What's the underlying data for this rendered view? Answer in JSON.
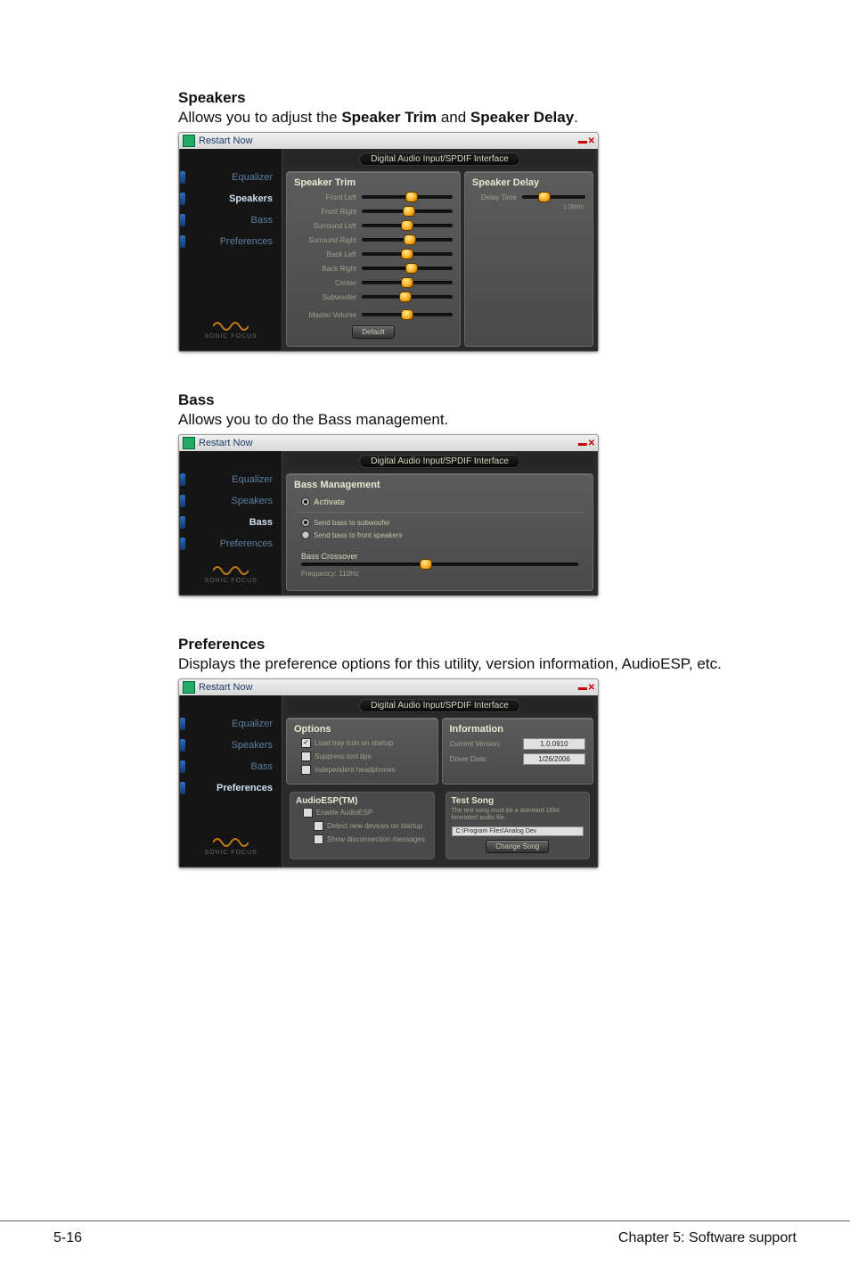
{
  "sections": {
    "speakers": {
      "heading": "Speakers",
      "desc_pre": "Allows you to adjust the ",
      "bold1": "Speaker Trim",
      "join": " and ",
      "bold2": "Speaker Delay",
      "desc_post": "."
    },
    "bass": {
      "heading": "Bass",
      "desc": "Allows you to do the Bass management."
    },
    "prefs": {
      "heading": "Preferences",
      "desc": "Displays the preference options for this utility, version information, AudioESP, etc."
    }
  },
  "shot": {
    "titlebar": "Restart Now",
    "pill": "Digital Audio Input/SPDIF Interface",
    "sidebar": {
      "items": [
        "Equalizer",
        "Speakers",
        "Bass",
        "Preferences"
      ],
      "brand_label": "SONIC FOCUS"
    }
  },
  "speakers_panel": {
    "left_title": "Speaker Trim",
    "right_title": "Speaker Delay",
    "delay_unit": "1.00ms",
    "sliders": [
      "Front Left",
      "Front Right",
      "Surround Left",
      "Surround Right",
      "Back Left",
      "Back Right",
      "Center",
      "Subwoofer"
    ],
    "master": "Master Volume",
    "delay_slider": "Delay Time",
    "btn": "Default"
  },
  "bass_panel": {
    "title": "Bass Management",
    "activate": "Activate",
    "opt1": "Send bass to subwoofer",
    "opt2": "Send bass to front speakers",
    "crossover": "Bass Crossover",
    "freq": "Frequency: 110Hz"
  },
  "prefs_panel": {
    "options_title": "Options",
    "opt_tray": "Load tray icon on startup",
    "opt_tips": "Suppress tool tips",
    "opt_ind": "Independent headphones",
    "esp_title": "AudioESP(TM)",
    "esp_enable": "Enable AudioESP",
    "esp_detect": "Detect new devices on startup",
    "esp_msgs": "Show disconnection messages",
    "info_title": "Information",
    "cv_label": "Current Version:",
    "cv_value": "1.0.0910",
    "dd_label": "Driver Date:",
    "dd_value": "1/26/2006",
    "ts_title": "Test Song",
    "ts_desc": "The test song must be a standard 16bit formatted audio file.",
    "ts_path": "C:\\Program Files\\Analog Dev",
    "ts_btn": "Change Song"
  },
  "footer": {
    "left": "5-16",
    "right": "Chapter 5: Software support"
  }
}
